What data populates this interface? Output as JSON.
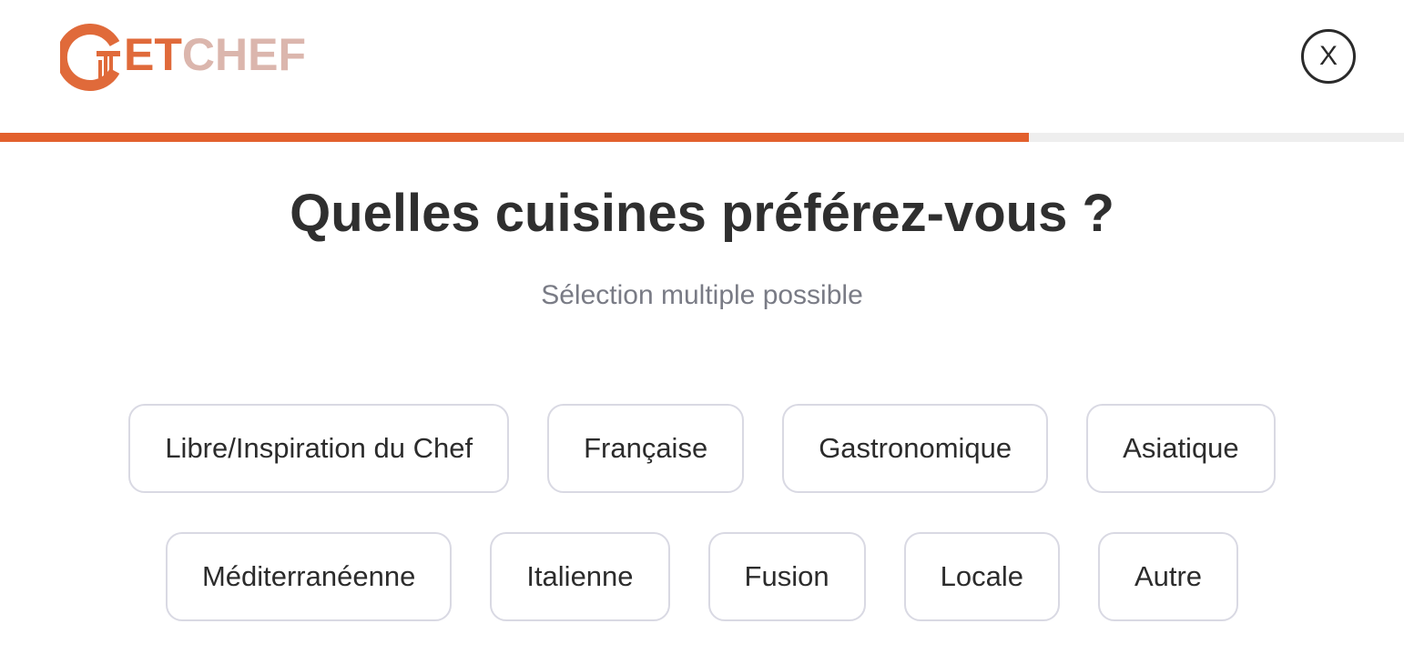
{
  "header": {
    "logo": {
      "part_et": "ET",
      "part_chef": "CHEF",
      "brand_colors": {
        "primary": "#e06a3a",
        "secondary": "#dbb6ad"
      }
    },
    "close_label": "X"
  },
  "progress": {
    "fraction": 0.733,
    "fill_color": "#e2602d",
    "track_color": "#eeeeee"
  },
  "question": {
    "title": "Quelles cuisines préférez-vous ?",
    "subtitle": "Sélection multiple possible"
  },
  "options": [
    {
      "label": "Libre/Inspiration du Chef",
      "selected": false
    },
    {
      "label": "Française",
      "selected": false
    },
    {
      "label": "Gastronomique",
      "selected": false
    },
    {
      "label": "Asiatique",
      "selected": false
    },
    {
      "label": "Méditerranéenne",
      "selected": false
    },
    {
      "label": "Italienne",
      "selected": false
    },
    {
      "label": "Fusion",
      "selected": false
    },
    {
      "label": "Locale",
      "selected": false
    },
    {
      "label": "Autre",
      "selected": false
    }
  ]
}
